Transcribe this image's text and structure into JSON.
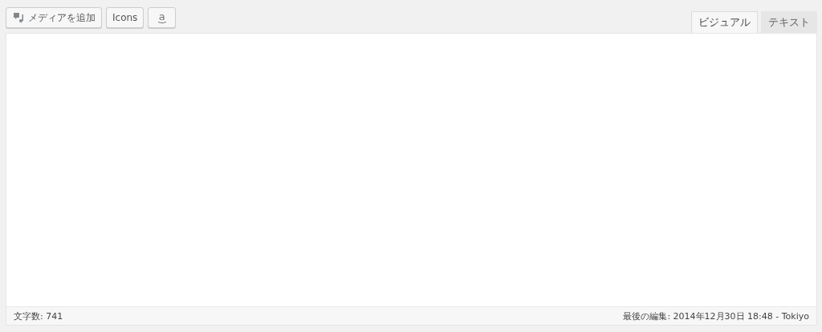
{
  "toolbar": {
    "buttons": [
      {
        "kind": "media",
        "label": "メディアを追加"
      },
      {
        "kind": "plain",
        "label": "Icons"
      },
      {
        "kind": "amazon",
        "label": "a"
      }
    ]
  },
  "tabs": [
    {
      "label": "ビジュアル",
      "selected": true
    },
    {
      "label": "テキスト",
      "selected": false
    }
  ],
  "status_bar": {
    "word_count": "文字数: 741",
    "last_edited": "最後の編集: 2014年12月30日 18:48 - Tokiyo"
  }
}
